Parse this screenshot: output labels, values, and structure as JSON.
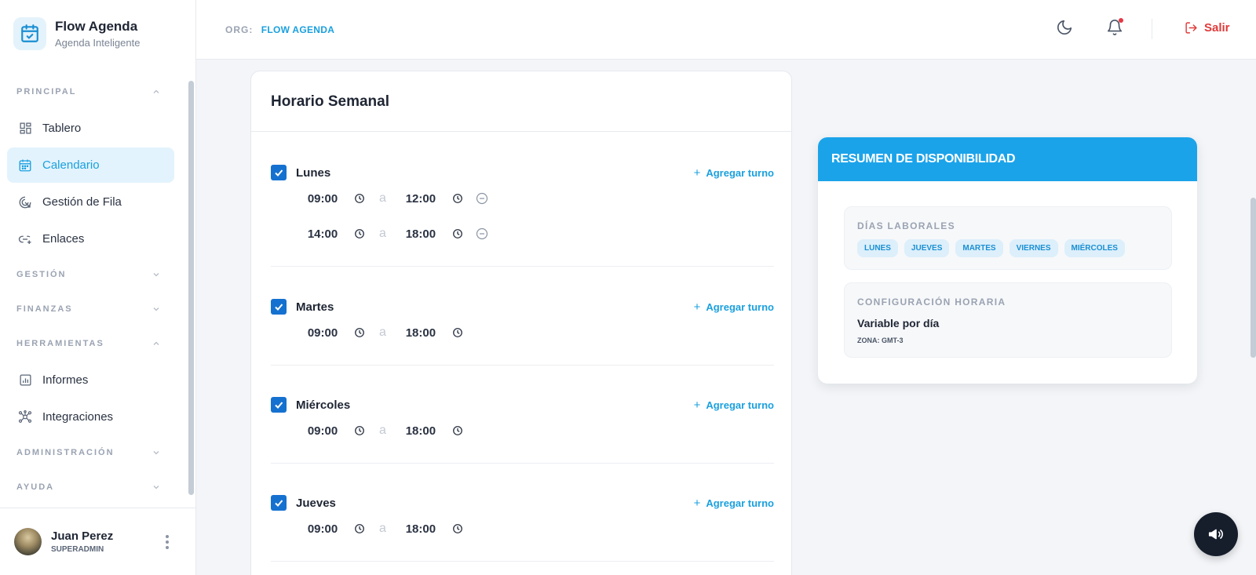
{
  "brand": {
    "title": "Flow Agenda",
    "subtitle": "Agenda Inteligente",
    "logo_icon": "calendar-check-icon"
  },
  "sidebar": {
    "sections": {
      "principal": "PRINCIPAL",
      "gestion": "GESTIÓN",
      "finanzas": "FINANZAS",
      "herramientas": "HERRAMIENTAS",
      "administracion": "ADMINISTRACIÓN",
      "ayuda": "AYUDA"
    },
    "items": {
      "tablero": "Tablero",
      "calendario": "Calendario",
      "gestion_fila": "Gestión de Fila",
      "enlaces": "Enlaces",
      "informes": "Informes",
      "integraciones": "Integraciones"
    },
    "active_item": "calendario"
  },
  "user": {
    "name": "Juan Perez",
    "role": "SUPERADMIN"
  },
  "header": {
    "org_label": "ORG:",
    "org_value": "FLOW AGENDA",
    "logout_label": "Salir",
    "icons": [
      "moon-icon",
      "bell-icon",
      "logout-icon"
    ]
  },
  "schedule": {
    "title": "Horario Semanal",
    "add_shift_label": "Agregar turno",
    "separator": "a",
    "days": [
      {
        "name": "Lunes",
        "checked": true,
        "shifts": [
          {
            "from": "09:00",
            "to": "12:00"
          },
          {
            "from": "14:00",
            "to": "18:00"
          }
        ]
      },
      {
        "name": "Martes",
        "checked": true,
        "shifts": [
          {
            "from": "09:00",
            "to": "18:00"
          }
        ]
      },
      {
        "name": "Miércoles",
        "checked": true,
        "shifts": [
          {
            "from": "09:00",
            "to": "18:00"
          }
        ]
      },
      {
        "name": "Jueves",
        "checked": true,
        "shifts": [
          {
            "from": "09:00",
            "to": "18:00"
          }
        ]
      }
    ]
  },
  "summary": {
    "title": "RESUMEN DE DISPONIBILIDAD",
    "workdays_label": "DÍAS LABORALES",
    "workdays": [
      "LUNES",
      "JUEVES",
      "MARTES",
      "VIERNES",
      "MIÉRCOLES"
    ],
    "config_label": "CONFIGURACIÓN HORARIA",
    "config_value": "Variable por día",
    "zone": "ZONA: GMT-3"
  },
  "colors": {
    "accent": "#1aa0de",
    "checkbox": "#1571d0",
    "summary_header": "#1ba3ea",
    "danger": "#e03a3a"
  }
}
